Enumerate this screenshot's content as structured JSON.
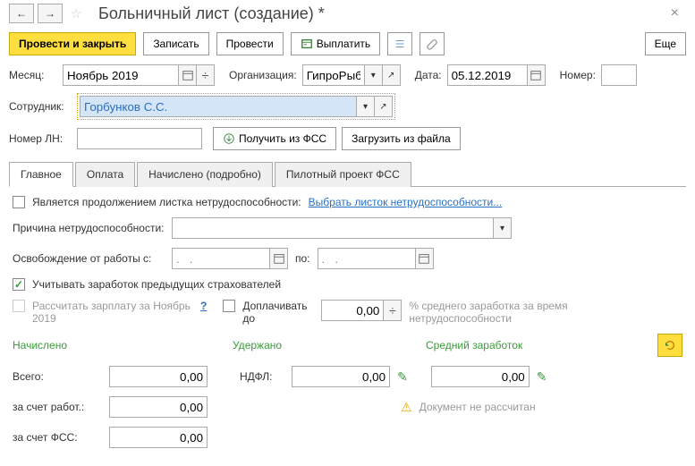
{
  "header": {
    "title": "Больничный лист (создание) *"
  },
  "toolbar": {
    "submit_close": "Провести и закрыть",
    "save": "Записать",
    "submit": "Провести",
    "pay": "Выплатить",
    "more": "Еще"
  },
  "filters": {
    "month_label": "Месяц:",
    "month_value": "Ноябрь 2019",
    "org_label": "Организация:",
    "org_value": "ГипроРыба",
    "date_label": "Дата:",
    "date_value": "05.12.2019",
    "number_label": "Номер:"
  },
  "employee": {
    "label": "Сотрудник:",
    "value": "Горбунков С.С."
  },
  "ln": {
    "label": "Номер ЛН:",
    "get_fss": "Получить из ФСС",
    "load_file": "Загрузить из файла"
  },
  "tabs": {
    "main": "Главное",
    "payment": "Оплата",
    "accrued": "Начислено (подробно)",
    "pilot": "Пилотный проект ФСС"
  },
  "main": {
    "continuation_label": "Является продолжением листка нетрудоспособности:",
    "select_sheet": "Выбрать листок нетрудоспособности...",
    "reason_label": "Причина нетрудоспособности:",
    "release_label": "Освобождение от работы с:",
    "date_placeholder": ".   .     ",
    "to_label": "по:",
    "prev_insurers": "Учитывать заработок предыдущих страхователей",
    "recalc_salary": "Рассчитать зарплату за Ноябрь 2019",
    "extra_pay_label": "Доплачивать до",
    "extra_pay_value": "0,00",
    "avg_note": "% среднего заработка за время нетрудоспособности",
    "col_accrued": "Начислено",
    "col_withheld": "Удержано",
    "col_avg": "Средний заработок",
    "total_label": "Всего:",
    "total_value": "0,00",
    "ndfl_label": "НДФЛ:",
    "ndfl_value": "0,00",
    "avg_value": "0,00",
    "employer_label": "за счет работ.:",
    "employer_value": "0,00",
    "fss_label": "за счет ФСС:",
    "fss_value": "0,00",
    "not_calculated": "Документ не рассчитан"
  }
}
